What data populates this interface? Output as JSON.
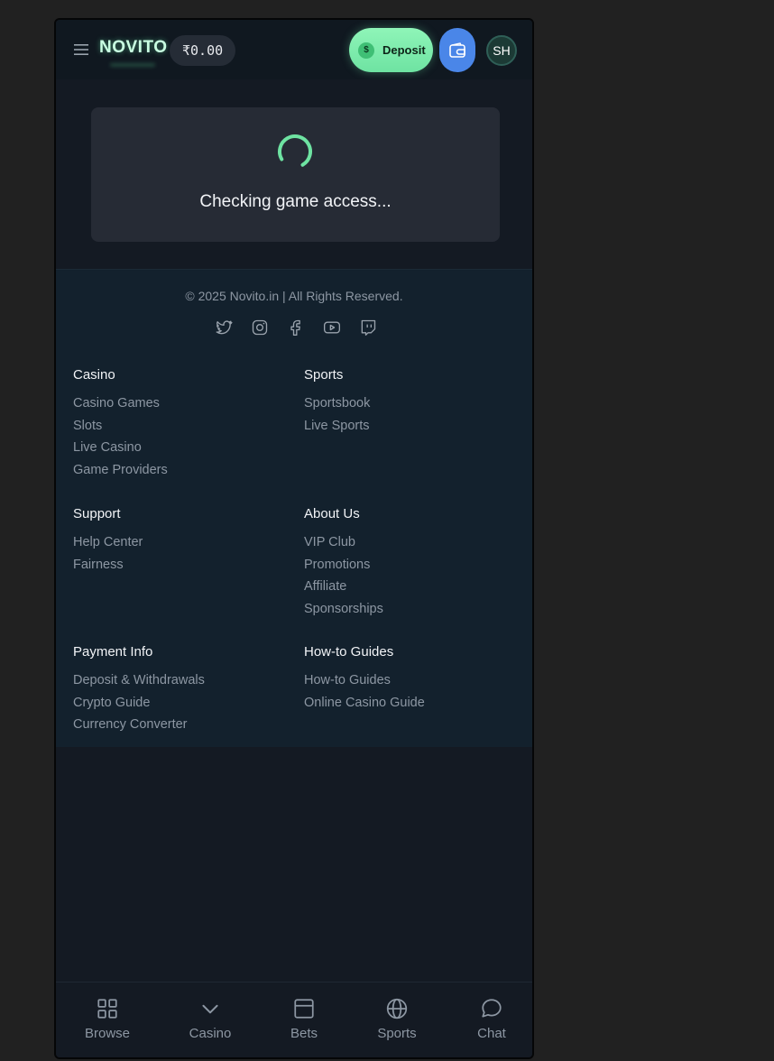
{
  "header": {
    "logo": "NOVITO",
    "balance": "₹0.00",
    "deposit_label": "Deposit",
    "deposit_icon_text": "$",
    "avatar_initials": "SH"
  },
  "loading": {
    "message": "Checking game access..."
  },
  "footer": {
    "copyright": "© 2025 Novito.in | All Rights Reserved.",
    "socials": [
      "twitter-icon",
      "instagram-icon",
      "facebook-icon",
      "youtube-icon",
      "twitch-icon"
    ],
    "columns": [
      {
        "title": "Casino",
        "links": [
          "Casino Games",
          "Slots",
          "Live Casino",
          "Game Providers"
        ]
      },
      {
        "title": "Sports",
        "links": [
          "Sportsbook",
          "Live Sports"
        ]
      },
      {
        "title": "Support",
        "links": [
          "Help Center",
          "Fairness"
        ]
      },
      {
        "title": "About Us",
        "links": [
          "VIP Club",
          "Promotions",
          "Affiliate",
          "Sponsorships"
        ]
      },
      {
        "title": "Payment Info",
        "links": [
          "Deposit & Withdrawals",
          "Crypto Guide",
          "Currency Converter"
        ]
      },
      {
        "title": "How-to Guides",
        "links": [
          "How-to Guides",
          "Online Casino Guide"
        ]
      }
    ]
  },
  "bottom_nav": [
    {
      "label": "Browse",
      "icon": "grid-icon"
    },
    {
      "label": "Casino",
      "icon": "chevron-down-icon"
    },
    {
      "label": "Bets",
      "icon": "bets-icon"
    },
    {
      "label": "Sports",
      "icon": "globe-icon"
    },
    {
      "label": "Chat",
      "icon": "chat-icon"
    }
  ],
  "colors": {
    "accent_green": "#6ee3a2",
    "wallet_blue": "#4a86e8",
    "background": "#141a23",
    "footer_bg": "#13212d"
  }
}
